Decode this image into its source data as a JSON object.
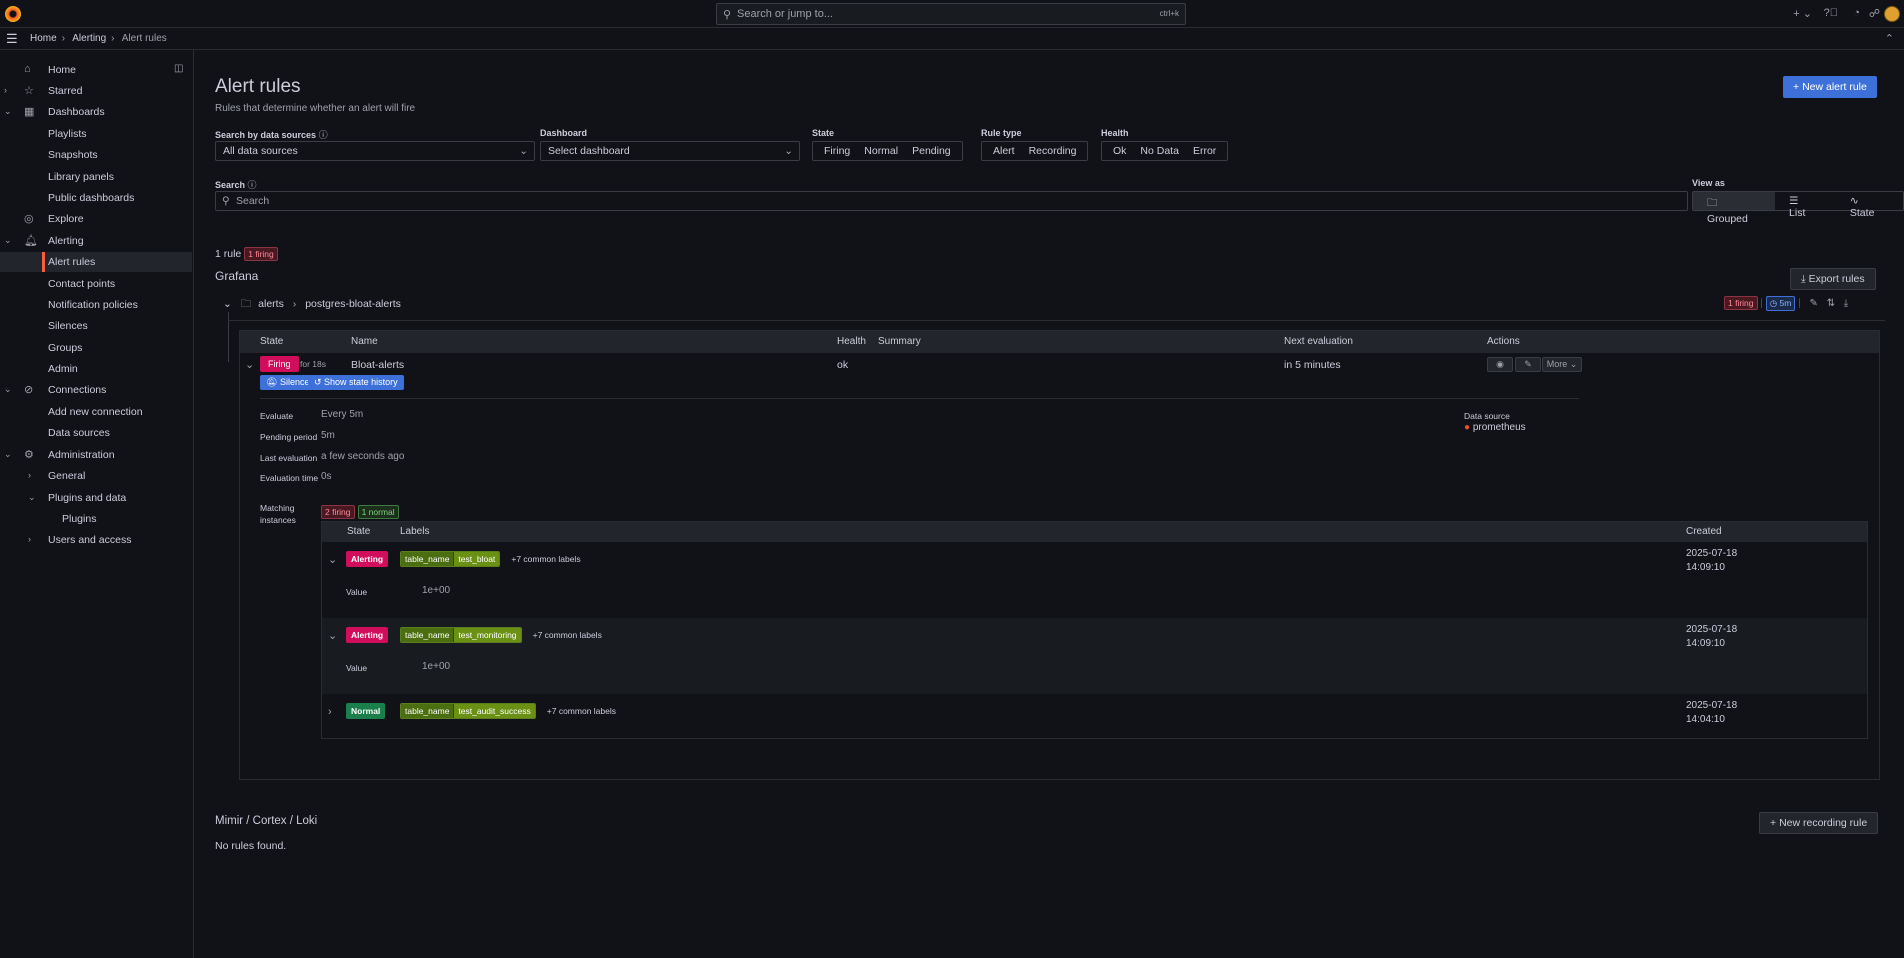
{
  "topbar": {
    "search_placeholder": "Search or jump to...",
    "search_shortcut": "ctrl+k",
    "plus_label": "+"
  },
  "breadcrumb": [
    "Home",
    "Alerting",
    "Alert rules"
  ],
  "sidebar": {
    "items": [
      {
        "label": "Home",
        "icon": "home-icon"
      },
      {
        "label": "Starred",
        "icon": "star-icon"
      },
      {
        "label": "Dashboards",
        "icon": "apps-icon"
      },
      {
        "label": "Playlists"
      },
      {
        "label": "Snapshots"
      },
      {
        "label": "Library panels"
      },
      {
        "label": "Public dashboards"
      },
      {
        "label": "Explore",
        "icon": "compass-icon"
      },
      {
        "label": "Alerting",
        "icon": "bell-icon"
      },
      {
        "label": "Alert rules"
      },
      {
        "label": "Contact points"
      },
      {
        "label": "Notification policies"
      },
      {
        "label": "Silences"
      },
      {
        "label": "Groups"
      },
      {
        "label": "Admin"
      },
      {
        "label": "Connections",
        "icon": "link-icon"
      },
      {
        "label": "Add new connection"
      },
      {
        "label": "Data sources"
      },
      {
        "label": "Administration",
        "icon": "cog-icon"
      },
      {
        "label": "General"
      },
      {
        "label": "Plugins and data"
      },
      {
        "label": "Plugins"
      },
      {
        "label": "Users and access"
      }
    ]
  },
  "page": {
    "title": "Alert rules",
    "subtitle": "Rules that determine whether an alert will fire",
    "new_alert_rule": "New alert rule"
  },
  "filters": {
    "datasource_label": "Search by data sources",
    "datasource_value": "All data sources",
    "dashboard_label": "Dashboard",
    "dashboard_value": "Select dashboard",
    "state_label": "State",
    "state_options": [
      "Firing",
      "Normal",
      "Pending"
    ],
    "ruletype_label": "Rule type",
    "ruletype_options": [
      "Alert",
      "Recording"
    ],
    "health_label": "Health",
    "health_options": [
      "Ok",
      "No Data",
      "Error"
    ],
    "search_label": "Search",
    "search_placeholder": "Search",
    "viewas_label": "View as",
    "viewas_options": [
      "Grouped",
      "List",
      "State"
    ]
  },
  "summary": {
    "count": "1 rule",
    "firing": "1 firing"
  },
  "grafana": {
    "title": "Grafana",
    "export": "Export rules",
    "folder": "alerts",
    "group": "postgres-bloat-alerts",
    "group_firing": "1 firing",
    "group_interval": "5m"
  },
  "rule_table": {
    "headers": [
      "State",
      "Name",
      "Health",
      "Summary",
      "Next evaluation",
      "Actions"
    ],
    "rule": {
      "state": "Firing",
      "for": "for 18s",
      "name": "Bloat-alerts",
      "health": "ok",
      "next_eval": "in 5 minutes",
      "more": "More",
      "silence": "Silence",
      "history": "Show state history"
    },
    "details": {
      "evaluate_k": "Evaluate",
      "evaluate_v": "Every 5m",
      "pending_k": "Pending period",
      "pending_v": "5m",
      "last_k": "Last evaluation",
      "last_v": "a few seconds ago",
      "time_k": "Evaluation time",
      "time_v": "0s",
      "ds_k": "Data source",
      "ds_v": "prometheus",
      "matching_k1": "Matching",
      "matching_k2": "instances",
      "matching_firing": "2 firing",
      "matching_normal": "1 normal"
    }
  },
  "instances": {
    "headers": [
      "State",
      "Labels",
      "Created"
    ],
    "value_label": "Value",
    "rows": [
      {
        "state": "Alerting",
        "key": "table_name",
        "val": "test_bloat",
        "common": "+7 common labels",
        "date": "2025-07-18",
        "time": "14:09:10",
        "value": "1e+00"
      },
      {
        "state": "Alerting",
        "key": "table_name",
        "val": "test_monitoring",
        "common": "+7 common labels",
        "date": "2025-07-18",
        "time": "14:09:10",
        "value": "1e+00"
      },
      {
        "state": "Normal",
        "key": "table_name",
        "val": "test_audit_success",
        "common": "+7 common labels",
        "date": "2025-07-18",
        "time": "14:04:10"
      }
    ]
  },
  "mimir": {
    "title": "Mimir / Cortex / Loki",
    "empty": "No rules found.",
    "new_recording": "New recording rule"
  }
}
